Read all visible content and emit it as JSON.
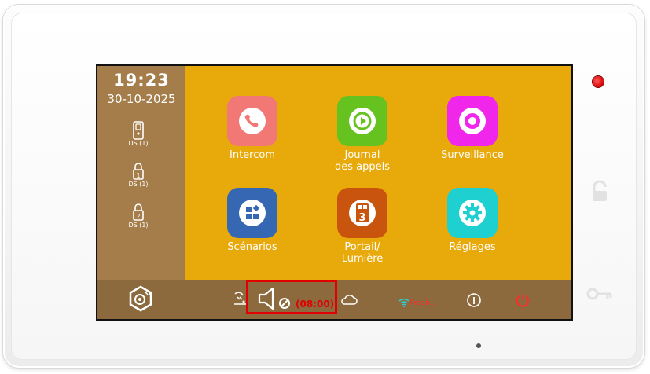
{
  "status": {
    "time": "19:23",
    "date": "30-10-2025"
  },
  "sidebar": {
    "items": [
      {
        "icon": "door-icon",
        "label": "DS (1)"
      },
      {
        "icon": "lock-1-icon",
        "label": "DS (1)",
        "number": "1"
      },
      {
        "icon": "lock-2-icon",
        "label": "DS (1)",
        "number": "2"
      }
    ]
  },
  "apps": [
    {
      "label": "Intercom",
      "icon": "phone-icon",
      "color": "#f27875"
    },
    {
      "label": "Journal\ndes appels",
      "icon": "call-log-icon",
      "color": "#66c21e"
    },
    {
      "label": "Surveillance",
      "icon": "camera-icon",
      "color": "#f026ea"
    },
    {
      "label": "Scénarios",
      "icon": "scenarios-icon",
      "color": "#3667b3"
    },
    {
      "label": "Portail/\nLumière",
      "icon": "gate-light-icon",
      "color": "#c8540e"
    },
    {
      "label": "Réglages",
      "icon": "gear-icon",
      "color": "#1ed0cf"
    }
  ],
  "bottom_bar": {
    "timer": "(08:00)",
    "wifi_name": "Freeb...",
    "icons": [
      "home-settings-icon",
      "shower-icon",
      "mute-icon",
      "cloud-icon",
      "wifi-icon",
      "info-icon",
      "power-icon"
    ]
  },
  "colors": {
    "main_bg": "#e8a90a",
    "sidebar_bg": "#a47d4a",
    "bottom_bar_bg": "#8c6a3e",
    "highlight": "#e00000",
    "led": "#d80000"
  }
}
